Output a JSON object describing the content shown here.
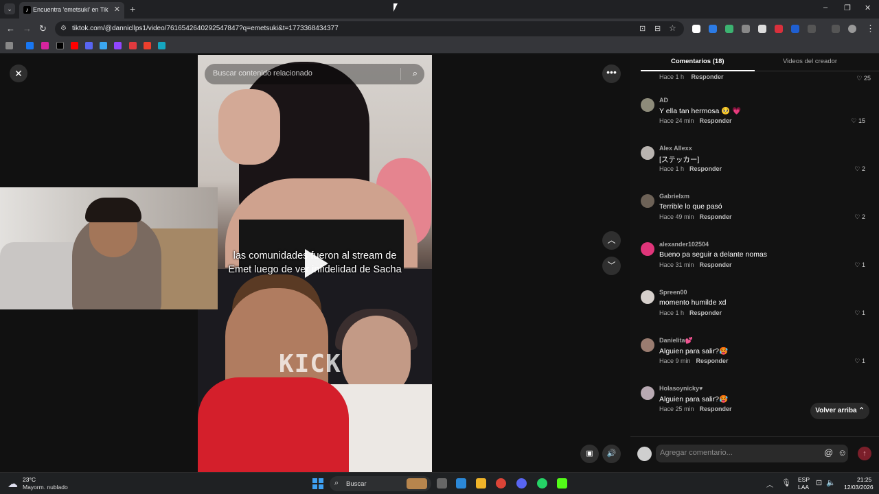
{
  "browser": {
    "tab_title": "Encuentra 'emetsuki' en TikTok",
    "tab_close": "✕",
    "new_tab": "+",
    "url": "tiktok.com/@dannicllps1/video/7616542640292547847?q=emetsuki&t=1773368434377",
    "window_controls": [
      "–",
      "❐",
      "✕"
    ]
  },
  "video": {
    "search_placeholder": "Buscar contenido relacionado",
    "caption_line1": "las comunidades fueron al stream de",
    "caption_line2": "Emet luego de ver infidelidad de Sacha",
    "watermark": "KICK"
  },
  "panel": {
    "tab_comments": "Comentarios (18)",
    "tab_videos": "Videos del creador",
    "top_meta_time": "Hace 1 h",
    "top_meta_likes": "♡ 25",
    "reply_label": "Responder",
    "comments": [
      {
        "user": "AD",
        "text": "Y ella tan hermosa 🥺 💗",
        "time": "Hace 24 min",
        "likes": "♡ 15",
        "avatar_color": "#8d8b7a"
      },
      {
        "user": "Alex Allexx",
        "text": "[ステッカー]",
        "time": "Hace 1 h",
        "likes": "♡ 2",
        "avatar_color": "#b9b4b0"
      },
      {
        "user": "Gabrielxm",
        "text": "Terrible lo que pasó",
        "time": "Hace 49 min",
        "likes": "♡ 2",
        "avatar_color": "#6d6257"
      },
      {
        "user": "alexander102504",
        "text": "Bueno pa seguir a delante nomas",
        "time": "Hace 31 min",
        "likes": "♡ 1",
        "avatar_color": "#e0357a"
      },
      {
        "user": "Spreen00",
        "text": "momento humilde xd",
        "time": "Hace 1 h",
        "likes": "♡ 1",
        "avatar_color": "#d6d0cc"
      },
      {
        "user": "Danielita💕",
        "text": "Alguien para salir?🥵",
        "time": "Hace 9 min",
        "likes": "♡ 1",
        "avatar_color": "#9a7c70"
      },
      {
        "user": "Holasoynicky♥",
        "text": "Alguien para salir?🥵",
        "time": "Hace 25 min",
        "likes": "",
        "avatar_color": "#b8a9b2"
      }
    ],
    "back_to_top": "Volver arriba ⌃",
    "comment_placeholder": "Agregar comentario..."
  },
  "taskbar": {
    "weather_temp": "23°C",
    "weather_desc": "Mayorm. nublado",
    "search_label": "Buscar",
    "lang1": "ESP",
    "lang2": "LAA",
    "time": "21:25",
    "date": "12/03/2026"
  },
  "colors": {
    "tiktok_bg": "#121212",
    "accent_red": "#fe2c55",
    "chrome_dark": "#202124"
  }
}
